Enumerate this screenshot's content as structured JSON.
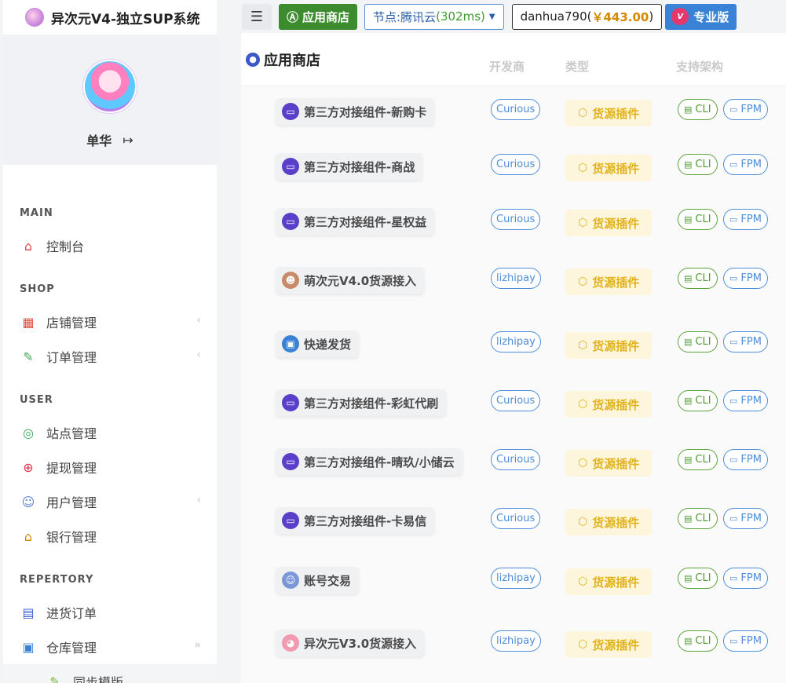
{
  "brand": {
    "title": "异次元V4-独立SUP系统"
  },
  "profile": {
    "name": "单华"
  },
  "nav": {
    "sections": [
      {
        "title": "MAIN",
        "items": [
          {
            "label": "控制台",
            "icon": "home-icon",
            "arrow": ""
          }
        ]
      },
      {
        "title": "SHOP",
        "items": [
          {
            "label": "店铺管理",
            "icon": "store-icon",
            "arrow": "‹"
          },
          {
            "label": "订单管理",
            "icon": "order-icon",
            "arrow": "‹"
          }
        ]
      },
      {
        "title": "USER",
        "items": [
          {
            "label": "站点管理",
            "icon": "www-icon",
            "arrow": ""
          },
          {
            "label": "提现管理",
            "icon": "withdraw-icon",
            "arrow": ""
          },
          {
            "label": "用户管理",
            "icon": "users-icon",
            "arrow": "‹"
          },
          {
            "label": "银行管理",
            "icon": "bank-icon",
            "arrow": ""
          }
        ]
      },
      {
        "title": "REPERTORY",
        "items": [
          {
            "label": "进货订单",
            "icon": "purchase-icon",
            "arrow": ""
          },
          {
            "label": "仓库管理",
            "icon": "warehouse-icon",
            "arrow": "»"
          }
        ]
      }
    ],
    "sub_item": "同步模版"
  },
  "topbar": {
    "store_label": "应用商店",
    "node_label": "节点:腾讯云",
    "node_ms": "(302ms)",
    "user": "danhua790",
    "balance": "￥443.00",
    "pro_label": "专业版",
    "pro_badge": "V"
  },
  "panel": {
    "title": "应用商店",
    "col_developer": "开发商",
    "col_type": "类型",
    "col_arch": "支持架构"
  },
  "apps": [
    {
      "name": "第三方对接组件-新购卡",
      "developer": "Curious",
      "type": "货源插件",
      "cli": "CLI",
      "fpm": "FPM",
      "icon": "monitor-icon"
    },
    {
      "name": "第三方对接组件-商战",
      "developer": "Curious",
      "type": "货源插件",
      "cli": "CLI",
      "fpm": "FPM",
      "icon": "monitor-icon"
    },
    {
      "name": "第三方对接组件-星权益",
      "developer": "Curious",
      "type": "货源插件",
      "cli": "CLI",
      "fpm": "FPM",
      "icon": "monitor-icon"
    },
    {
      "name": "萌次元V4.0货源接入",
      "developer": "lizhipay",
      "type": "货源插件",
      "cli": "CLI",
      "fpm": "FPM",
      "icon": "anime-avatar-icon"
    },
    {
      "name": "快递发货",
      "developer": "lizhipay",
      "type": "货源插件",
      "cli": "CLI",
      "fpm": "FPM",
      "icon": "package-icon"
    },
    {
      "name": "第三方对接组件-彩虹代刷",
      "developer": "Curious",
      "type": "货源插件",
      "cli": "CLI",
      "fpm": "FPM",
      "icon": "monitor-icon"
    },
    {
      "name": "第三方对接组件-晴玖/小储云",
      "developer": "Curious",
      "type": "货源插件",
      "cli": "CLI",
      "fpm": "FPM",
      "icon": "monitor-icon"
    },
    {
      "name": "第三方对接组件-卡易信",
      "developer": "Curious",
      "type": "货源插件",
      "cli": "CLI",
      "fpm": "FPM",
      "icon": "monitor-icon"
    },
    {
      "name": "账号交易",
      "developer": "lizhipay",
      "type": "货源插件",
      "cli": "CLI",
      "fpm": "FPM",
      "icon": "account-icon"
    },
    {
      "name": "异次元V3.0货源接入",
      "developer": "lizhipay",
      "type": "货源插件",
      "cli": "CLI",
      "fpm": "FPM",
      "icon": "anime-mascot-icon"
    }
  ]
}
